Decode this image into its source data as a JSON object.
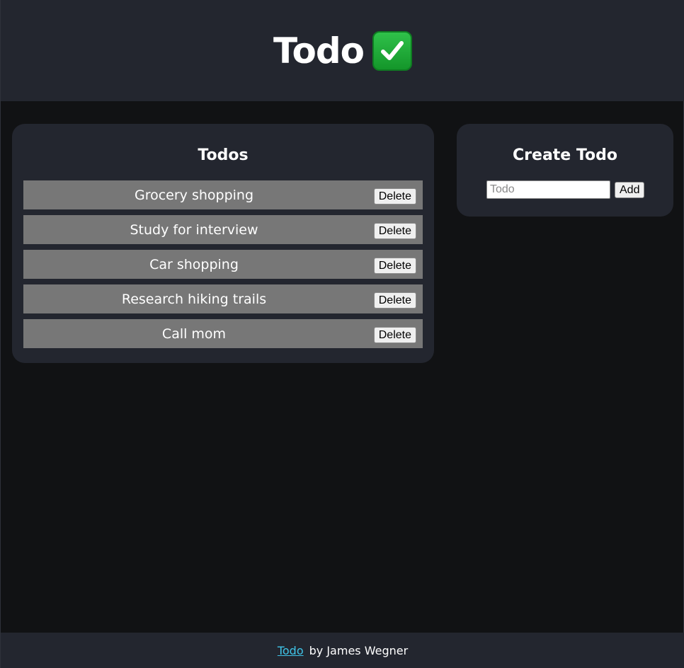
{
  "header": {
    "title": "Todo",
    "icon": "check-mark-icon",
    "icon_color": "#1fae3b"
  },
  "todos_panel": {
    "title": "Todos",
    "items": [
      {
        "text": "Grocery shopping",
        "delete_label": "Delete"
      },
      {
        "text": "Study for interview",
        "delete_label": "Delete"
      },
      {
        "text": "Car shopping",
        "delete_label": "Delete"
      },
      {
        "text": "Research hiking trails",
        "delete_label": "Delete"
      },
      {
        "text": "Call mom",
        "delete_label": "Delete"
      }
    ]
  },
  "create_panel": {
    "title": "Create Todo",
    "input_placeholder": "Todo",
    "input_value": "",
    "add_label": "Add"
  },
  "footer": {
    "link_text": "Todo",
    "credit": "by James Wegner",
    "link_color": "#3fc4e8"
  },
  "colors": {
    "background": "#111214",
    "panel": "#23262f",
    "row": "#777777"
  }
}
